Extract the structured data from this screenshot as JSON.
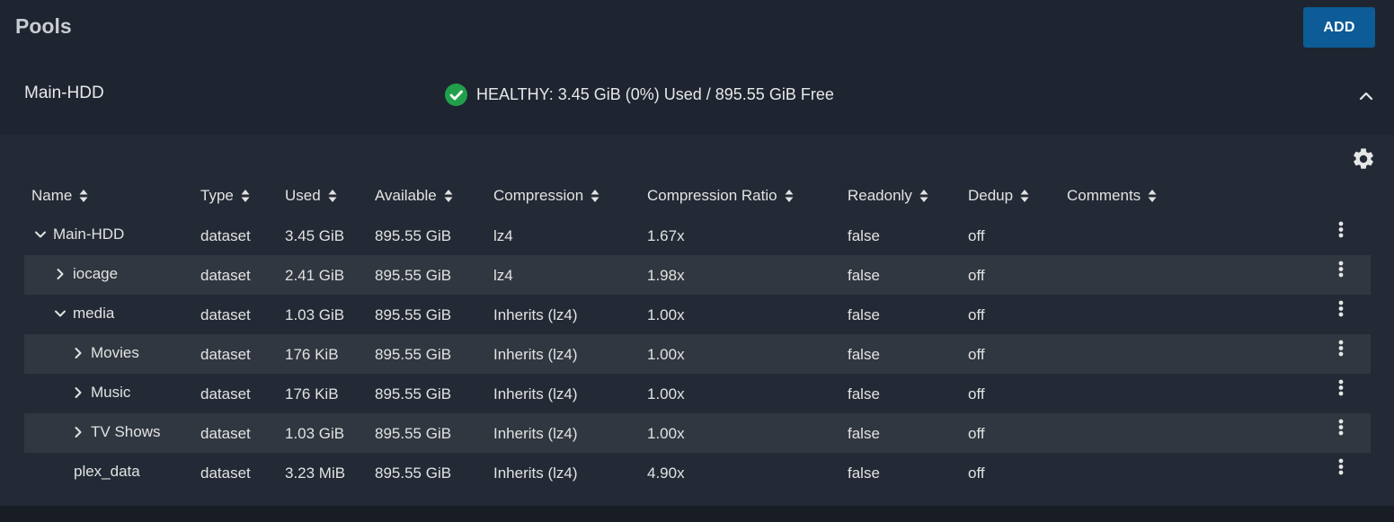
{
  "header": {
    "title": "Pools",
    "add_label": "ADD"
  },
  "pool": {
    "name": "Main-HDD",
    "status_text": "HEALTHY: 3.45 GiB (0%) Used / 895.55 GiB Free",
    "status_color": "#21a04c"
  },
  "icons": {
    "status": "check-circle-icon",
    "collapse": "chevron-up-icon",
    "settings": "gear-icon",
    "sort": "sort-icon",
    "row_menu": "more-vertical-icon",
    "expanded": "chevron-down-icon",
    "collapsed": "chevron-right-icon"
  },
  "table": {
    "columns": [
      "Name",
      "Type",
      "Used",
      "Available",
      "Compression",
      "Compression Ratio",
      "Readonly",
      "Dedup",
      "Comments"
    ],
    "rows": [
      {
        "name": "Main-HDD",
        "toggle": "expanded",
        "type": "dataset",
        "used": "3.45 GiB",
        "available": "895.55 GiB",
        "compression": "lz4",
        "ratio": "1.67x",
        "readonly": "false",
        "dedup": "off",
        "comments": ""
      },
      {
        "name": "iocage",
        "toggle": "collapsed",
        "type": "dataset",
        "used": "2.41 GiB",
        "available": "895.55 GiB",
        "compression": "lz4",
        "ratio": "1.98x",
        "readonly": "false",
        "dedup": "off",
        "comments": ""
      },
      {
        "name": "media",
        "toggle": "expanded",
        "type": "dataset",
        "used": "1.03 GiB",
        "available": "895.55 GiB",
        "compression": "Inherits (lz4)",
        "ratio": "1.00x",
        "readonly": "false",
        "dedup": "off",
        "comments": ""
      },
      {
        "name": "Movies",
        "toggle": "collapsed",
        "type": "dataset",
        "used": "176 KiB",
        "available": "895.55 GiB",
        "compression": "Inherits (lz4)",
        "ratio": "1.00x",
        "readonly": "false",
        "dedup": "off",
        "comments": ""
      },
      {
        "name": "Music",
        "toggle": "collapsed",
        "type": "dataset",
        "used": "176 KiB",
        "available": "895.55 GiB",
        "compression": "Inherits (lz4)",
        "ratio": "1.00x",
        "readonly": "false",
        "dedup": "off",
        "comments": ""
      },
      {
        "name": "TV Shows",
        "toggle": "collapsed",
        "type": "dataset",
        "used": "1.03 GiB",
        "available": "895.55 GiB",
        "compression": "Inherits (lz4)",
        "ratio": "1.00x",
        "readonly": "false",
        "dedup": "off",
        "comments": ""
      },
      {
        "name": "plex_data",
        "toggle": "none",
        "type": "dataset",
        "used": "3.23 MiB",
        "available": "895.55 GiB",
        "compression": "Inherits (lz4)",
        "ratio": "4.90x",
        "readonly": "false",
        "dedup": "off",
        "comments": ""
      }
    ]
  }
}
